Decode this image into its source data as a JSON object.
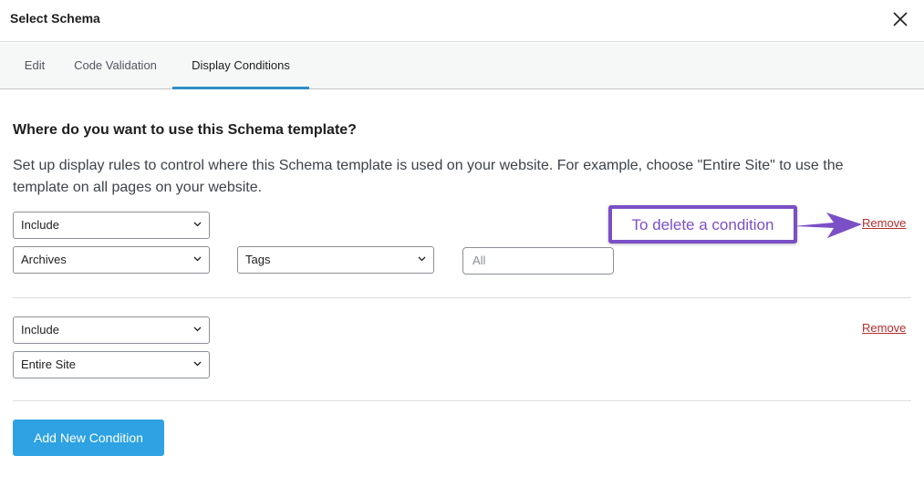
{
  "header": {
    "title": "Select Schema",
    "close_icon": "close-icon"
  },
  "tabs": [
    {
      "label": "Edit",
      "active": false
    },
    {
      "label": "Code Validation",
      "active": false
    },
    {
      "label": "Display Conditions",
      "active": true
    }
  ],
  "content": {
    "question": "Where do you want to use this Schema template?",
    "description": "Set up display rules to control where this Schema template is used on your website. For example, choose \"Entire Site\" to use the template on all pages on your website."
  },
  "conditions": [
    {
      "type": "Include",
      "category": "Archives",
      "subcategory": "Tags",
      "value_placeholder": "All",
      "remove_label": "Remove"
    },
    {
      "type": "Include",
      "category": "Entire Site",
      "remove_label": "Remove"
    }
  ],
  "annotation": {
    "text": "To delete a condition",
    "color": "#7b4fc6"
  },
  "actions": {
    "add_condition_label": "Add New Condition"
  },
  "colors": {
    "accent_tab": "#2f8fc5",
    "button_primary": "#2ea2e3",
    "remove_link": "#b32d2e"
  }
}
